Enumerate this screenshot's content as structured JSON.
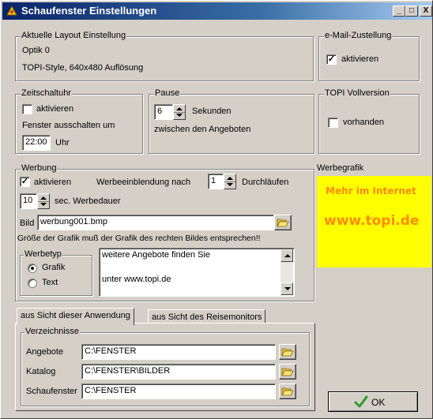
{
  "window": {
    "title": "Schaufenster Einstellungen",
    "controls": {
      "minimize": "_",
      "maximize": "□",
      "close": "X"
    }
  },
  "layout_group": {
    "legend": "Aktuelle Layout Einstellung",
    "line1": "Optik 0",
    "line2": "TOPI-Style, 640x480 Auflösung"
  },
  "email_group": {
    "legend": "e-Mail-Zustellung",
    "checkbox_label": "aktivieren",
    "checked": true
  },
  "timer_group": {
    "legend": "Zeitschaltuhr",
    "checkbox_label": "aktivieren",
    "checked": false,
    "off_label": "Fenster ausschalten um",
    "time_value": "22:00",
    "unit_label": "Uhr"
  },
  "pause_group": {
    "legend": "Pause",
    "value": "6",
    "unit_label": "Sekunden",
    "desc": "zwischen den Angeboten"
  },
  "full_version_group": {
    "legend": "TOPI Vollversion",
    "checkbox_label": "vorhanden",
    "checked": false
  },
  "ads_group": {
    "legend": "Werbung",
    "checkbox_label": "aktivieren",
    "checked": true,
    "insert_label": "Werbeeinblendung nach",
    "insert_value": "1",
    "insert_unit": "Durchläufen",
    "duration_value": "10",
    "duration_label": "sec. Werbedauer",
    "image_label": "Bild",
    "image_value": "werbung001.bmp",
    "size_hint": "Größe der Grafik muß der Grafik des rechten Bildes entsprechen!!",
    "type_legend": "Werbetyp",
    "type_options": [
      "Grafik",
      "Text"
    ],
    "type_selected": "Grafik",
    "text_line1": "weitere Angebote finden Sie",
    "text_line2": "unter www.topi.de"
  },
  "ad_graphic": {
    "label": "Werbegrafik",
    "line1": "Mehr im Internet",
    "line2": "www.topi.de",
    "bg_color": "#ffff00",
    "text_color": "#ff8c00"
  },
  "tabs": [
    {
      "label": "aus Sicht dieser Anwendung",
      "active": true
    },
    {
      "label": "aus Sicht des Reisemonitors",
      "active": false
    }
  ],
  "directories": {
    "legend": "Verzeichnisse",
    "rows": [
      {
        "label": "Angebote",
        "value": "C:\\FENSTER"
      },
      {
        "label": "Katalog",
        "value": "C:\\FENSTER\\BILDER"
      },
      {
        "label": "Schaufenster",
        "value": "C:\\FENSTER"
      }
    ]
  },
  "ok_button": {
    "label": "OK",
    "icon": "checkmark-icon"
  },
  "icons": {
    "folder": "folder-open-icon",
    "app": "app-icon"
  },
  "colors": {
    "title_start": "#0a246a",
    "title_end": "#a6caf0",
    "face": "#d4d0c8",
    "check_green": "#2e9a2e"
  }
}
